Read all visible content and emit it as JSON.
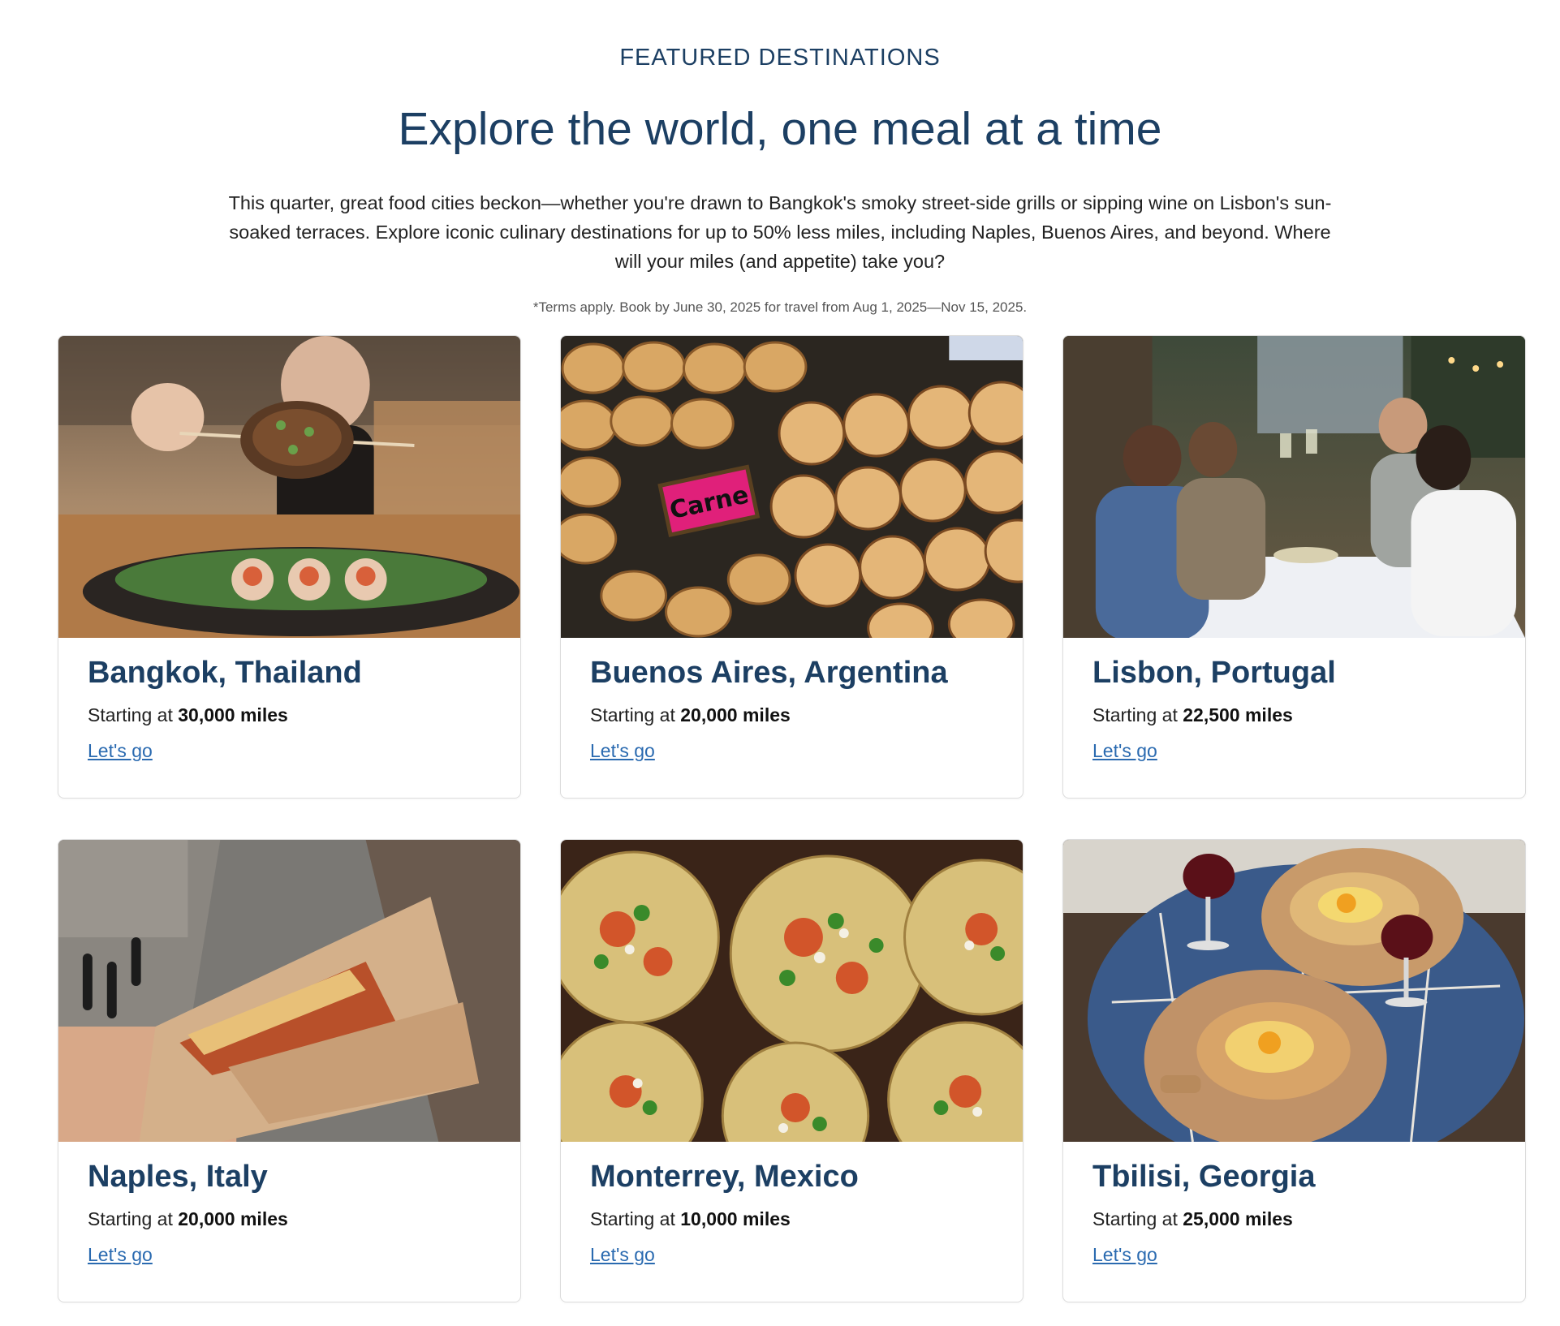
{
  "header": {
    "eyebrow": "FEATURED DESTINATIONS",
    "title": "Explore the world, one meal at a time",
    "intro": "This quarter, great food cities beckon—whether you're drawn to Bangkok's smoky street-side grills or sipping wine on Lisbon's sun-soaked terraces. Explore iconic culinary destinations for up to 50% less miles, including Naples, Buenos Aires, and beyond. Where will your miles (and appetite) take you?",
    "terms": "*Terms apply. Book by June 30, 2025 for travel from Aug 1, 2025—Nov 15, 2025."
  },
  "colors": {
    "heading": "#1c3f63",
    "link": "#2a6ab0",
    "card_border": "#dcdcdc"
  },
  "cards": [
    {
      "title": "Bangkok, Thailand",
      "price_prefix": "Starting at",
      "miles": "30,000 miles",
      "link": "Let's go",
      "image": "grilled-skewer-photo"
    },
    {
      "title": "Buenos Aires, Argentina",
      "price_prefix": "Starting at",
      "miles": "20,000 miles",
      "link": "Let's go",
      "image": "empanadas-photo",
      "sign_text": "Carne"
    },
    {
      "title": "Lisbon, Portugal",
      "price_prefix": "Starting at",
      "miles": "22,500 miles",
      "link": "Let's go",
      "image": "terrace-dinner-photo"
    },
    {
      "title": "Naples, Italy",
      "price_prefix": "Starting at",
      "miles": "20,000 miles",
      "link": "Let's go",
      "image": "folded-pizza-photo"
    },
    {
      "title": "Monterrey, Mexico",
      "price_prefix": "Starting at",
      "miles": "10,000 miles",
      "link": "Let's go",
      "image": "tacos-photo"
    },
    {
      "title": "Tbilisi, Georgia",
      "price_prefix": "Starting at",
      "miles": "25,000 miles",
      "link": "Let's go",
      "image": "khachapuri-photo"
    }
  ]
}
